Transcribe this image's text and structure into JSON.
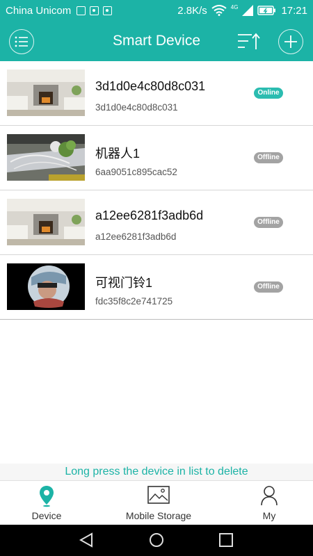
{
  "status_bar": {
    "carrier": "China Unicom",
    "speed": "2.8K/s",
    "network": "4G",
    "time": "17:21"
  },
  "header": {
    "title": "Smart Device"
  },
  "devices": [
    {
      "name": "3d1d0e4c80d8c031",
      "id": "3d1d0e4c80d8c031",
      "status": "Online"
    },
    {
      "name": "机器人1",
      "id": "6aa9051c895cac52",
      "status": "Offline"
    },
    {
      "name": "a12ee6281f3adb6d",
      "id": "a12ee6281f3adb6d",
      "status": "Offline"
    },
    {
      "name": "可视门铃1",
      "id": "fdc35f8c2e741725",
      "status": "Offline"
    }
  ],
  "hint": "Long press the device in list to delete",
  "bottom_nav": {
    "device": "Device",
    "storage": "Mobile Storage",
    "my": "My"
  },
  "colors": {
    "accent": "#1cb3a6",
    "online_badge": "#2bbcb0",
    "offline_badge": "#a3a3a3"
  },
  "icons": {
    "menu": "list-menu-icon",
    "sort": "sort-icon",
    "add": "plus-icon",
    "device": "location-pin-icon",
    "storage": "image-icon",
    "my": "person-icon"
  }
}
